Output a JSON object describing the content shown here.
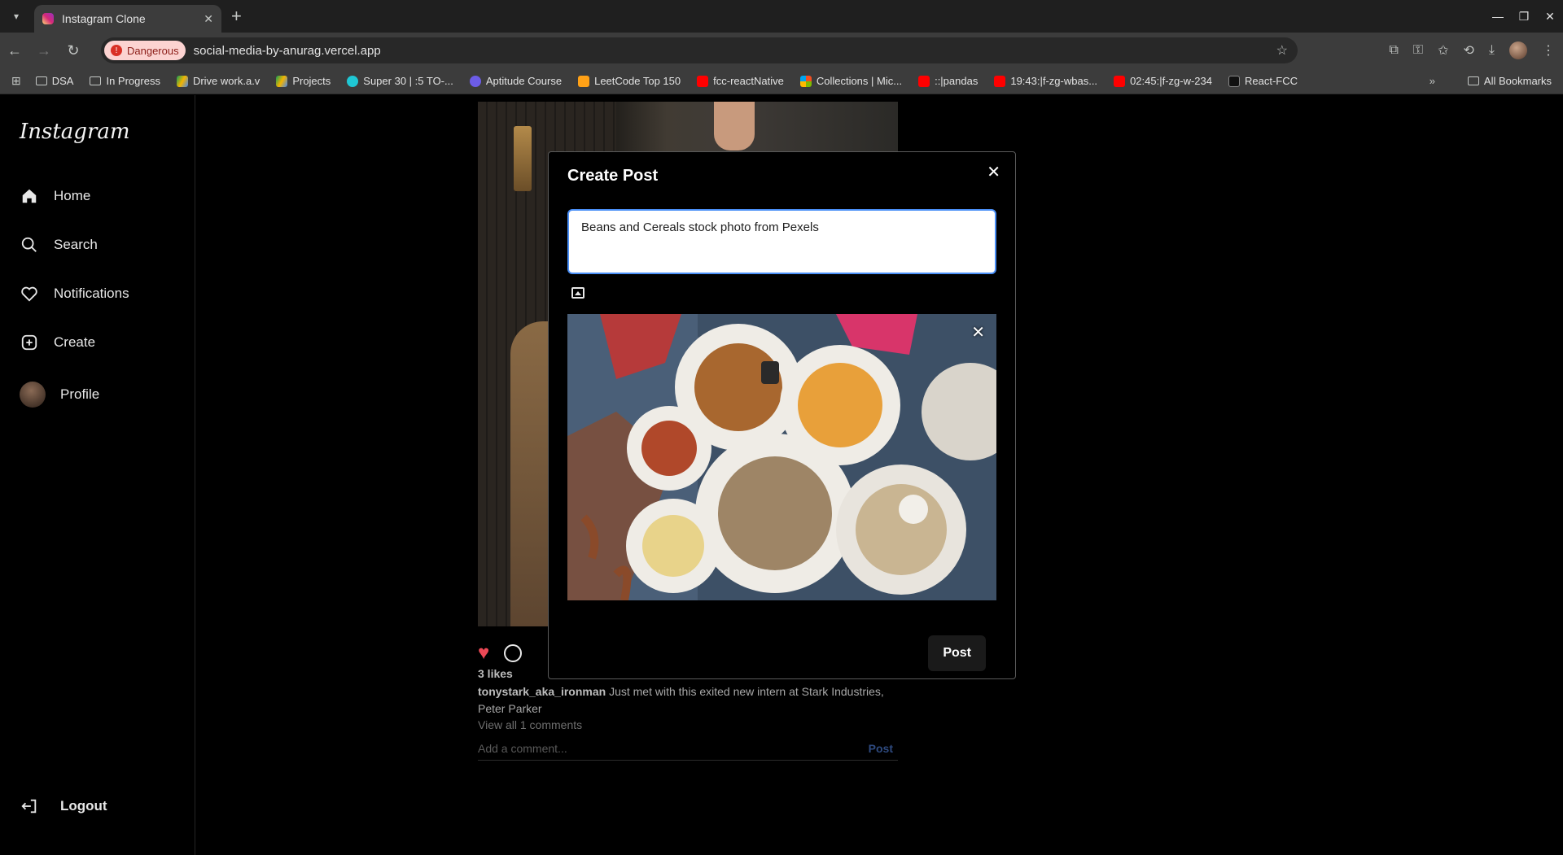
{
  "browser": {
    "tab_title": "Instagram Clone",
    "security_label": "Dangerous",
    "url": "social-media-by-anurag.vercel.app",
    "bookmarks": [
      "DSA",
      "In Progress",
      "Drive work.a.v",
      "Projects",
      "Super 30 | :5 TO-...",
      "Aptitude Course",
      "LeetCode Top 150",
      "fcc-reactNative",
      "Collections | Mic...",
      "::|pandas",
      "19:43:|f-zg-wbas...",
      "02:45:|f-zg-w-234",
      "React-FCC"
    ],
    "all_bookmarks": "All Bookmarks",
    "colors": {
      "danger_bg": "#fcd3d1",
      "danger_text": "#8c1d18"
    }
  },
  "app": {
    "logo": "Instagram",
    "nav": {
      "home": "Home",
      "search": "Search",
      "notifications": "Notifications",
      "create": "Create",
      "profile": "Profile",
      "logout": "Logout"
    },
    "post": {
      "likes": "3 likes",
      "username": "tonystark_aka_ironman",
      "caption": "Just met with this exited new intern at Stark Industries, Peter Parker",
      "view_comments": "View all 1 comments",
      "comment_placeholder": "Add a comment...",
      "comment_post": "Post"
    },
    "modal": {
      "title": "Create Post",
      "caption_value": "Beans and Cereals stock photo from Pexels",
      "post_button": "Post"
    }
  }
}
